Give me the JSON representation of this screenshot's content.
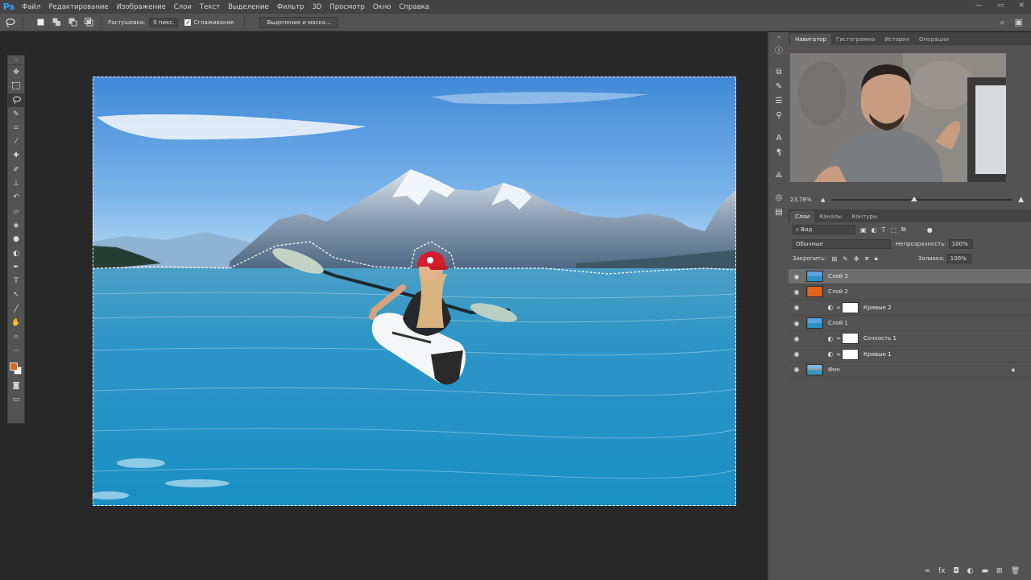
{
  "app": {
    "logo": "Ps",
    "menu": [
      "Файл",
      "Редактирование",
      "Изображение",
      "Слои",
      "Текст",
      "Выделение",
      "Фильтр",
      "3D",
      "Просмотр",
      "Окно",
      "Справка"
    ],
    "window_controls": [
      "—",
      "▭",
      "✕"
    ]
  },
  "options": {
    "feather_label": "Растушевка:",
    "feather_value": "0 пикс.",
    "antialias_label": "Сглаживание",
    "select_mask_button": "Выделение и маска..."
  },
  "colors": {
    "foreground": "#e0661c",
    "background": "#ffffff"
  },
  "right_panel": {
    "top_tabs": [
      "Навигатор",
      "Гистограмма",
      "История",
      "Операции"
    ],
    "zoom": "23,78%",
    "layers_tabs": [
      "Слои",
      "Каналы",
      "Контуры"
    ],
    "kind_filter": "Вид",
    "blend_mode": "Обычные",
    "opacity_label": "Непрозрачность:",
    "opacity_value": "100%",
    "lock_label": "Закрепить:",
    "fill_label": "Заливка:",
    "fill_value": "100%",
    "layers": [
      {
        "name": "Слой 3",
        "type": "image",
        "selected": true
      },
      {
        "name": "Слой 2",
        "type": "color",
        "color": "#e0661c"
      },
      {
        "name": "Кривые 2",
        "type": "adjustment"
      },
      {
        "name": "Слой 1",
        "type": "image"
      },
      {
        "name": "Сочность 1",
        "type": "adjustment"
      },
      {
        "name": "Кривые 1",
        "type": "adjustment"
      },
      {
        "name": "Фон",
        "type": "background",
        "locked": true
      }
    ]
  }
}
